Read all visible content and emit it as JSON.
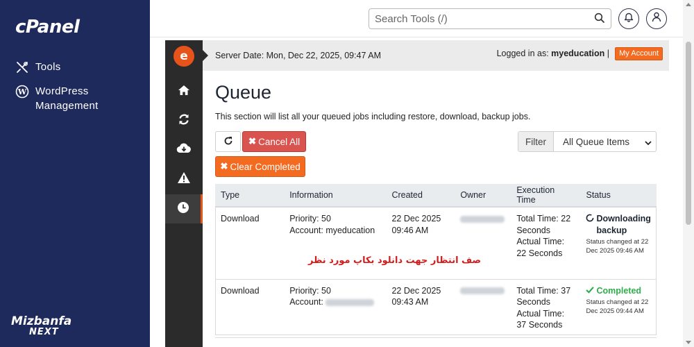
{
  "cpanel_sidebar": {
    "logo_text": "cPanel",
    "items": [
      {
        "label": "Tools",
        "icon": "tools-icon"
      },
      {
        "label": "WordPress Management",
        "icon": "wordpress-icon"
      }
    ],
    "brand_line1": "Mizbanfa",
    "brand_line2": "NEXT"
  },
  "topbar": {
    "search_placeholder": "Search Tools (/)",
    "icons": [
      "search-icon",
      "bell-icon",
      "user-icon"
    ]
  },
  "plugin_sidebar": {
    "logo_letter": "e",
    "items": [
      "home-icon",
      "refresh-icon",
      "cloud-download-icon",
      "warning-icon",
      "clock-icon"
    ],
    "active_item": "clock-icon"
  },
  "server_bar": {
    "server_date": "Server Date: Mon, Dec 22, 2025, 09:47 AM",
    "logged_in_prefix": "Logged in as: ",
    "username": "myeducation",
    "separator": " |",
    "my_account_label": "My Account",
    "accent_color": "#f26b21"
  },
  "page": {
    "title": "Queue",
    "description": "This section will list all your queued jobs including restore, download, backup jobs."
  },
  "toolbar": {
    "cancel_all_label": "Cancel All",
    "clear_completed_label": "Clear Completed",
    "filter_label": "Filter",
    "filter_selected": "All Queue Items",
    "cancel_color": "#d9534f",
    "clear_color": "#f26b21"
  },
  "table": {
    "headers": [
      "Type",
      "Information",
      "Created",
      "Owner",
      "Execution Time",
      "Status"
    ],
    "rows": [
      {
        "type": "Download",
        "priority": "Priority: 50",
        "account": "Account: myeducation",
        "created_date": "22 Dec 2025",
        "created_time": "09:46 AM",
        "exec_total": "Total Time: 22 Seconds",
        "exec_actual": "Actual Time: 22 Seconds",
        "status": "Downloading backup",
        "status_note": "Status changed at 22 Dec 2025 09:46 AM"
      },
      {
        "type": "Download",
        "priority": "Priority: 50",
        "account": "Account: ",
        "created_date": "22 Dec 2025",
        "created_time": "09:43 AM",
        "exec_total": "Total Time: 37 Seconds",
        "exec_actual": "Actual Time: 37 Seconds",
        "status": "Completed",
        "status_note": "Status changed at 22 Dec 2025 09:44 AM",
        "status_color": "#2eae4c"
      }
    ]
  },
  "annotation": "صف انتظار جهت دانلود بکاپ مورد نظر"
}
